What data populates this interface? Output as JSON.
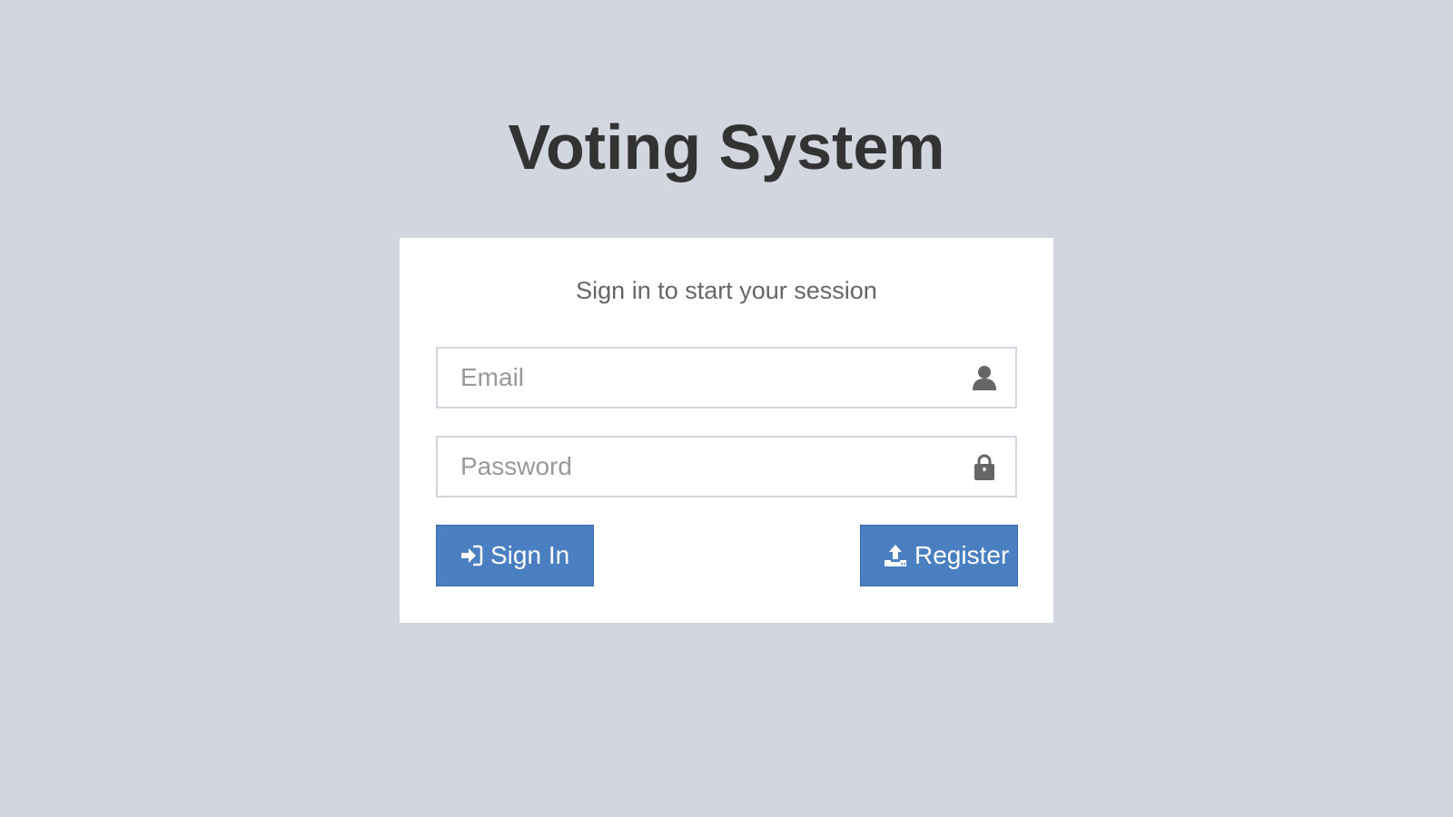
{
  "app": {
    "title": "Voting System"
  },
  "login": {
    "message": "Sign in to start your session",
    "email": {
      "placeholder": "Email",
      "value": "",
      "icon": "user-icon"
    },
    "password": {
      "placeholder": "Password",
      "value": "",
      "icon": "lock-icon"
    },
    "signin_button": {
      "label": "Sign In",
      "icon": "sign-in-icon"
    },
    "register_button": {
      "label": "Register",
      "icon": "upload-icon"
    }
  },
  "colors": {
    "background": "#d2d6de",
    "card": "#ffffff",
    "primary": "#4a7fc1",
    "title_text": "#333333"
  }
}
